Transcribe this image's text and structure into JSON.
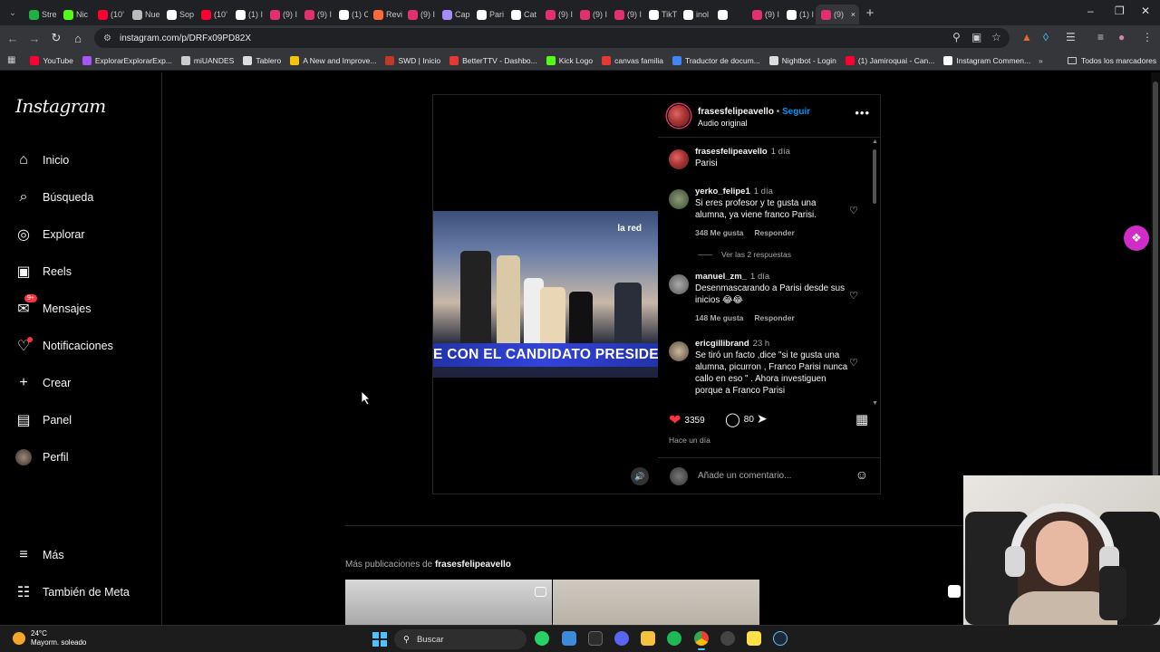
{
  "browser": {
    "tabs": [
      {
        "label": "Stre",
        "color": "#1fb141"
      },
      {
        "label": "Nic",
        "color": "#53fc18"
      },
      {
        "label": "(10’",
        "color": "#ff0033"
      },
      {
        "label": "Nue",
        "color": "#bbbbbb"
      },
      {
        "label": "Sop",
        "color": "#ffffff"
      },
      {
        "label": "(10’",
        "color": "#ff0033"
      },
      {
        "label": "(1) I",
        "color": "#ffffff"
      },
      {
        "label": "(9) I",
        "color": "#e1306c"
      },
      {
        "label": "(9) I",
        "color": "#e1306c"
      },
      {
        "label": "(1) C",
        "color": "#ffffff"
      },
      {
        "label": "Revi",
        "color": "#ff6a3d"
      },
      {
        "label": "(9) I",
        "color": "#e1306c"
      },
      {
        "label": "Cap",
        "color": "#a78bfa"
      },
      {
        "label": "Pari",
        "color": "#ffffff"
      },
      {
        "label": "Cat",
        "color": "#ffffff"
      },
      {
        "label": "(9) I",
        "color": "#e1306c"
      },
      {
        "label": "(9) I",
        "color": "#e1306c"
      },
      {
        "label": "(9) I",
        "color": "#e1306c"
      },
      {
        "label": "TikT",
        "color": "#ffffff"
      },
      {
        "label": "inol",
        "color": "#ffffff"
      },
      {
        "label": "",
        "color": "#ffffff"
      },
      {
        "label": "(9) I",
        "color": "#e1306c"
      },
      {
        "label": "(1) I",
        "color": "#ffffff"
      }
    ],
    "active_tab_label": "(9)",
    "url": "instagram.com/p/DRFx09PD82X",
    "bookmarks": [
      {
        "label": "YouTube",
        "color": "#ff0033"
      },
      {
        "label": "ExplorarExplorarExp...",
        "color": "#a855f7"
      },
      {
        "label": "miUANDES",
        "color": "#cccccc"
      },
      {
        "label": "Tablero",
        "color": "#dddddd"
      },
      {
        "label": "A New and Improve...",
        "color": "#f4c20d"
      },
      {
        "label": "SWD | Inicio",
        "color": "#c0392b"
      },
      {
        "label": "BetterTTV - Dashbo...",
        "color": "#e53935"
      },
      {
        "label": "Kick Logo",
        "color": "#53fc18"
      },
      {
        "label": "canvas familia",
        "color": "#e53935"
      },
      {
        "label": "Traductor de docum...",
        "color": "#4285f4"
      },
      {
        "label": "Nightbot - Login",
        "color": "#dddddd"
      },
      {
        "label": "(1) Jamiroquai - Can...",
        "color": "#ff0033"
      },
      {
        "label": "Instagram Commen...",
        "color": "#ffffff"
      }
    ],
    "all_bookmarks": "Todos los marcadores"
  },
  "sidebar": {
    "logo": "Instagram",
    "items": [
      {
        "label": "Inicio",
        "icon": "home-icon"
      },
      {
        "label": "Búsqueda",
        "icon": "search-icon"
      },
      {
        "label": "Explorar",
        "icon": "compass-icon"
      },
      {
        "label": "Reels",
        "icon": "reels-icon"
      },
      {
        "label": "Mensajes",
        "icon": "messenger-icon",
        "badge": "9+"
      },
      {
        "label": "Notificaciones",
        "icon": "heart-icon"
      },
      {
        "label": "Crear",
        "icon": "plus-icon"
      },
      {
        "label": "Panel",
        "icon": "chart-icon"
      },
      {
        "label": "Perfil",
        "icon": "avatar-icon"
      }
    ],
    "bottom": [
      {
        "label": "Más",
        "icon": "menu-icon"
      },
      {
        "label": "También de Meta",
        "icon": "meta-icon"
      }
    ]
  },
  "post": {
    "video_caption": "E CON EL CANDIDATO PRESIDE",
    "video_logo": "la red",
    "author": "frasesfelipeavello",
    "follow": "Seguir",
    "separator": "•",
    "audio": "Audio original",
    "comments": [
      {
        "user": "frasesfelipeavello",
        "time": "1 día",
        "text": "Parisi",
        "likes": "",
        "reply": ""
      },
      {
        "user": "yerko_felipe1",
        "time": "1 día",
        "text": "Si eres profesor y te gusta una alumna, ya viene franco Parisi.",
        "likes": "348 Me gusta",
        "reply": "Responder"
      },
      {
        "user": "manuel_zm_",
        "time": "1 día",
        "text": "Desenmascarando a Parisi desde sus inicios 😂😂",
        "likes": "148 Me gusta",
        "reply": "Responder"
      },
      {
        "user": "ericgillibrand",
        "time": "23 h",
        "text": "Se tiró un facto ,dice \"si te gusta una alumna, picurron , Franco Parisi nunca callo en eso \" . Ahora investiguen porque a Franco Parisi",
        "likes": "",
        "reply": ""
      }
    ],
    "view_replies": "Ver las 2 respuestas",
    "like_count": "3359",
    "comment_count": "80",
    "time_ago": "Hace un día",
    "add_comment_placeholder": "Añade un comentario..."
  },
  "more_posts": {
    "prefix": "Más publicaciones de",
    "user": "frasesfelipeavello"
  },
  "taskbar": {
    "temperature": "24°C",
    "weather": "Mayorm. soleado",
    "search": "Buscar"
  }
}
